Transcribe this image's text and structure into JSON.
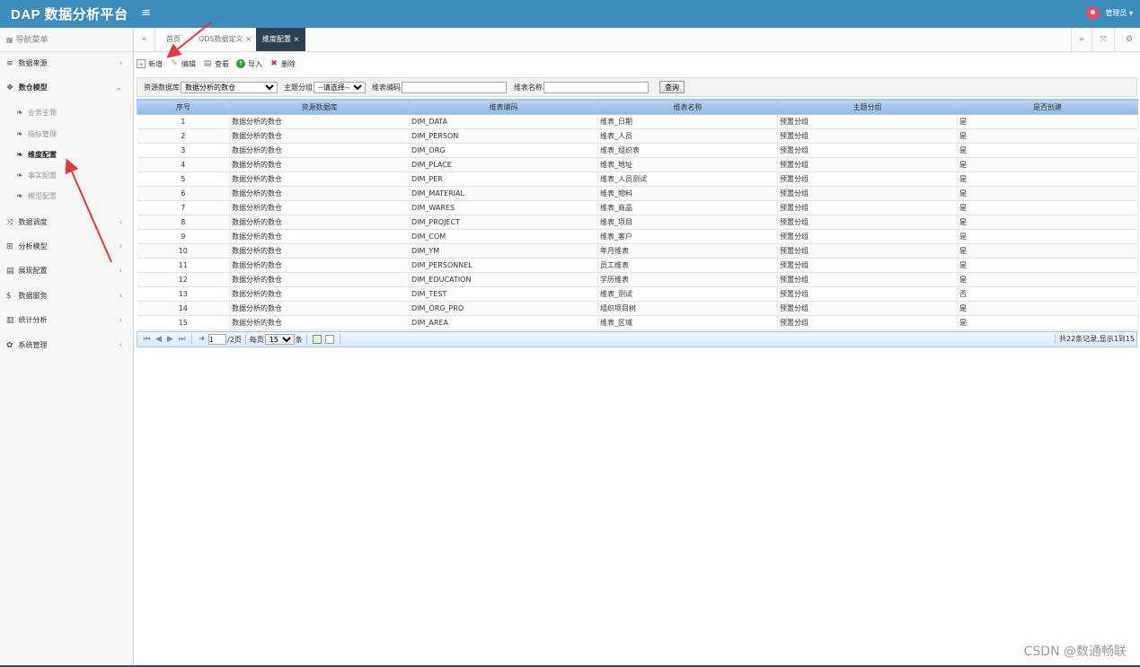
{
  "header": {
    "app_title": "DAP 数据分析平台",
    "menu_icon": "≡",
    "user": "管理员 ▾"
  },
  "sidebar": {
    "title": "导航菜单",
    "items": [
      {
        "icon": "database-icon",
        "glyph": "≡",
        "label": "数据来源",
        "arrow": "‹"
      },
      {
        "icon": "cubes-icon",
        "glyph": "❖",
        "label": "数仓模型",
        "arrow": "⌄"
      },
      {
        "icon": "random-icon",
        "glyph": "⤨",
        "label": "数据调度",
        "arrow": "‹"
      },
      {
        "icon": "sitemap-icon",
        "glyph": "⊞",
        "label": "分析模型",
        "arrow": "‹"
      },
      {
        "icon": "film-icon",
        "glyph": "▤",
        "label": "展现配置",
        "arrow": "‹"
      },
      {
        "icon": "dollar-icon",
        "glyph": "$",
        "label": "数据服务",
        "arrow": "‹"
      },
      {
        "icon": "bar-chart-icon",
        "glyph": "▥",
        "label": "统计分析",
        "arrow": "‹"
      },
      {
        "icon": "gear-icon",
        "glyph": "✿",
        "label": "系统管理",
        "arrow": "‹"
      }
    ],
    "sub_items": [
      {
        "label": "业务主题"
      },
      {
        "label": "指标管理"
      },
      {
        "label": "维度配置"
      },
      {
        "label": "事实配置"
      },
      {
        "label": "模型配置"
      }
    ]
  },
  "tabs": {
    "items": [
      {
        "label": "首页"
      },
      {
        "label": "ODS数据定义 ×"
      },
      {
        "label": "维度配置 ×"
      }
    ]
  },
  "toolbar": {
    "add": "新增",
    "edit": "编辑",
    "view": "查看",
    "import": "导入",
    "delete": "删除"
  },
  "search": {
    "lib_label": "资源数据库",
    "lib_value": "数据分析的数仓",
    "group_label": "主题分组",
    "group_value": "--请选择--",
    "code_label": "维表编码",
    "name_label": "维表名称",
    "query": "查询"
  },
  "table": {
    "columns": [
      "序号",
      "资源数据库",
      "维表编码",
      "维表名称",
      "主题分组",
      "是否创建"
    ],
    "rows": [
      [
        "1",
        "数据分析的数仓",
        "DIM_DATA",
        "维表_日期",
        "预置分组",
        "是"
      ],
      [
        "2",
        "数据分析的数仓",
        "DIM_PERSON",
        "维表_人员",
        "预置分组",
        "是"
      ],
      [
        "3",
        "数据分析的数仓",
        "DIM_ORG",
        "维表_组织表",
        "预置分组",
        "是"
      ],
      [
        "4",
        "数据分析的数仓",
        "DIM_PLACE",
        "维表_地址",
        "预置分组",
        "是"
      ],
      [
        "5",
        "数据分析的数仓",
        "DIM_PER",
        "维表_人员测试",
        "预置分组",
        "是"
      ],
      [
        "6",
        "数据分析的数仓",
        "DIM_MATERIAL",
        "维表_物料",
        "预置分组",
        "是"
      ],
      [
        "7",
        "数据分析的数仓",
        "DIM_WARES",
        "维表_商品",
        "预置分组",
        "是"
      ],
      [
        "8",
        "数据分析的数仓",
        "DIM_PROJECT",
        "维表_项目",
        "预置分组",
        "是"
      ],
      [
        "9",
        "数据分析的数仓",
        "DIM_COM",
        "维表_客户",
        "预置分组",
        "是"
      ],
      [
        "10",
        "数据分析的数仓",
        "DIM_YM",
        "年月维表",
        "预置分组",
        "是"
      ],
      [
        "11",
        "数据分析的数仓",
        "DIM_PERSONNEL",
        "员工维表",
        "预置分组",
        "是"
      ],
      [
        "12",
        "数据分析的数仓",
        "DIM_EDUCATION",
        "学历维表",
        "预置分组",
        "是"
      ],
      [
        "13",
        "数据分析的数仓",
        "DIM_TEST",
        "维表_测试",
        "预置分组",
        "否"
      ],
      [
        "14",
        "数据分析的数仓",
        "DIM_ORG_PRO",
        "组织项目树",
        "预置分组",
        "是"
      ],
      [
        "15",
        "数据分析的数仓",
        "DIM_AREA",
        "维表_区域",
        "预置分组",
        "是"
      ]
    ]
  },
  "pager": {
    "current_page": "1",
    "total_pages": "/2页",
    "per_page_label": "每页",
    "per_page_value": "15",
    "unit": "条",
    "info": "共22条记录,显示1到15"
  },
  "watermark": "CSDN @数通畅联",
  "colors": {
    "header": "#3c8dbc",
    "active_tab": "#2f4050",
    "annotation_arrow": "#e53935"
  }
}
